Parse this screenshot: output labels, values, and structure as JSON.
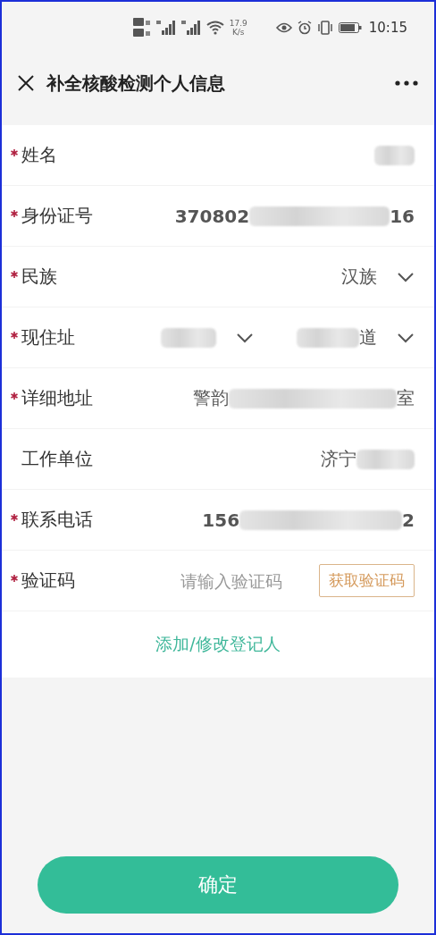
{
  "status_bar": {
    "speed_value": "17.9",
    "speed_unit": "K/s",
    "time": "10:15"
  },
  "header": {
    "title": "补全核酸检测个人信息"
  },
  "fields": [
    {
      "kind": "text",
      "label": "姓名",
      "required": true,
      "redacted": true
    },
    {
      "kind": "text",
      "label": "身份证号",
      "required": true,
      "value_before": "370802",
      "value_after": "16",
      "redacted": true
    },
    {
      "kind": "select",
      "label": "民族",
      "required": true,
      "value": "汉族"
    },
    {
      "kind": "region",
      "label": "现住址",
      "required": true,
      "value_after": "道"
    },
    {
      "kind": "text",
      "label": "详细地址",
      "required": true,
      "value_before": "警韵",
      "value_after": "室",
      "redacted": true
    },
    {
      "kind": "text",
      "label": "工作单位",
      "required": false,
      "value_before": "济宁",
      "redacted": true
    },
    {
      "kind": "text",
      "label": "联系电话",
      "required": true,
      "value_before": "156",
      "value_after": "2",
      "redacted": true
    },
    {
      "kind": "code",
      "label": "验证码",
      "required": true,
      "placeholder": "请输入验证码",
      "button": "获取验证码"
    }
  ],
  "link": "添加/修改登记人",
  "confirm_button": "确定"
}
